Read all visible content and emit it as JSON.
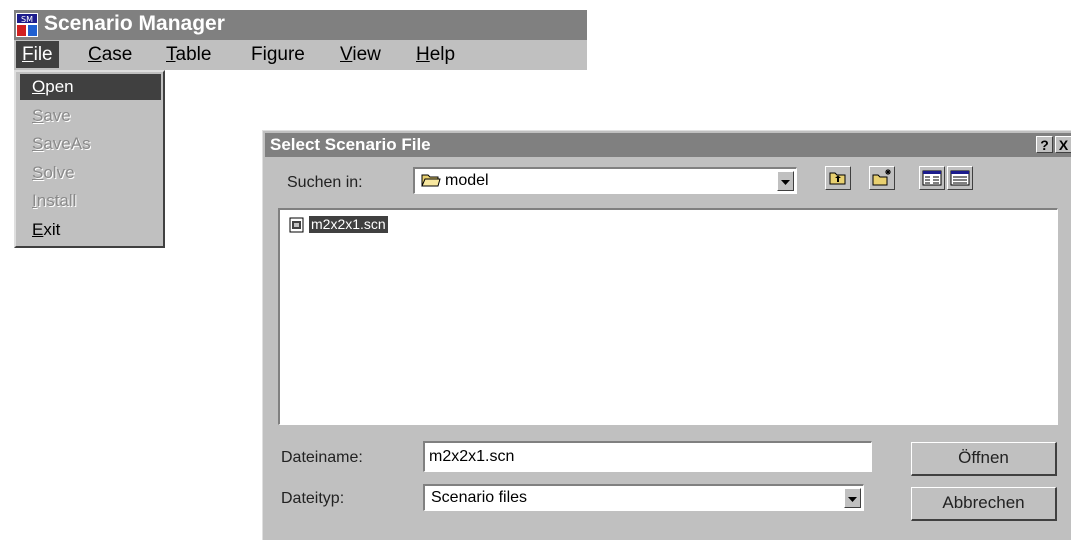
{
  "app": {
    "title": "Scenario Manager",
    "icon": "scenario-manager-app-icon",
    "icon_text": "SM"
  },
  "menubar": {
    "items": [
      {
        "label": "File",
        "active": true
      },
      {
        "label": "Case"
      },
      {
        "label": "Table"
      },
      {
        "label": "Figure"
      },
      {
        "label": "View"
      },
      {
        "label": "Help"
      }
    ]
  },
  "file_menu": {
    "items": [
      {
        "label": "Open",
        "state": "highlighted"
      },
      {
        "label": "Save",
        "state": "disabled"
      },
      {
        "label": "SaveAs",
        "state": "disabled"
      },
      {
        "label": "Solve",
        "state": "disabled"
      },
      {
        "label": "Install",
        "state": "disabled"
      },
      {
        "label": "Exit",
        "state": "enabled"
      }
    ]
  },
  "dialog": {
    "title": "Select Scenario File",
    "help_button": "?",
    "close_button": "X",
    "look_in_label": "Suchen in:",
    "look_in_value": "model",
    "look_in_icon": "folder-icon",
    "toolbar_icons": [
      "up-one-level-icon",
      "new-folder-icon",
      "list-view-icon",
      "details-view-icon"
    ],
    "files": [
      {
        "name": "m2x2x1.scn",
        "icon": "scn-file-icon",
        "selected": true
      }
    ],
    "filename_label": "Dateiname:",
    "filename_value": "m2x2x1.scn",
    "filetype_label": "Dateityp:",
    "filetype_value": "Scenario files",
    "open_button": "Öffnen",
    "cancel_button": "Abbrechen"
  },
  "colors": {
    "titlebar": "#808080",
    "face": "#c0c0c0",
    "highlight": "#404040",
    "disabled_text": "#8a8a8a"
  }
}
